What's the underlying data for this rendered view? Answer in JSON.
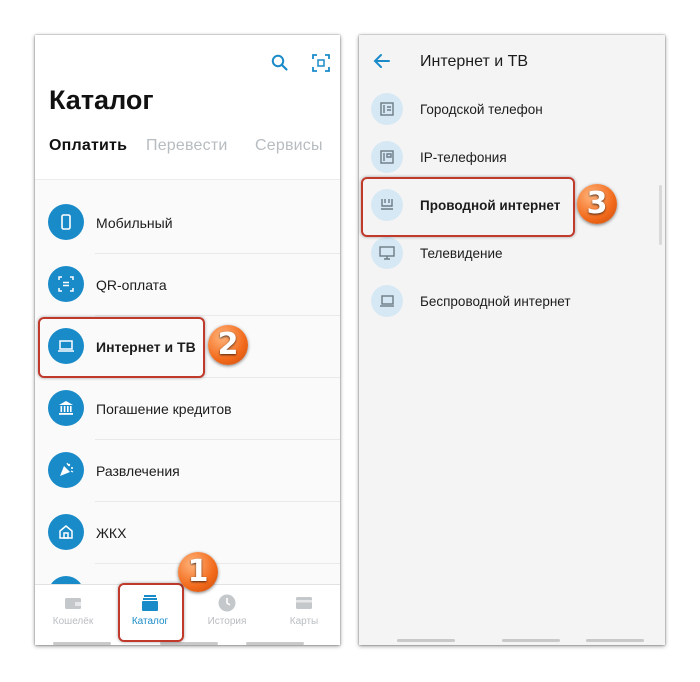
{
  "left": {
    "header": {
      "title": "Каталог",
      "search_icon": "search-icon",
      "qr_icon": "qr-scan-icon"
    },
    "tabs": [
      {
        "label": "Оплатить",
        "active": true
      },
      {
        "label": "Перевести",
        "active": false
      },
      {
        "label": "Сервисы",
        "active": false
      }
    ],
    "items": [
      {
        "label": "Мобильный",
        "icon": "phone-icon"
      },
      {
        "label": "QR-оплата",
        "icon": "qr-icon"
      },
      {
        "label": "Интернет и ТВ",
        "icon": "laptop-icon"
      },
      {
        "label": "Погашение кредитов",
        "icon": "bank-icon"
      },
      {
        "label": "Развлечения",
        "icon": "party-icon"
      },
      {
        "label": "ЖКХ",
        "icon": "house-icon"
      }
    ],
    "bottom_nav": [
      {
        "label": "Кошелёк",
        "icon": "wallet-icon",
        "active": false
      },
      {
        "label": "Каталог",
        "icon": "catalog-icon",
        "active": true
      },
      {
        "label": "История",
        "icon": "clock-icon",
        "active": false
      },
      {
        "label": "Карты",
        "icon": "card-icon",
        "active": false
      }
    ]
  },
  "right": {
    "header": {
      "title": "Интернет и ТВ",
      "back_icon": "back-arrow-icon"
    },
    "items": [
      {
        "label": "Городской телефон",
        "icon": "landline-icon"
      },
      {
        "label": "IP-телефония",
        "icon": "ip-phone-icon"
      },
      {
        "label": "Проводной интернет",
        "icon": "router-icon"
      },
      {
        "label": "Телевидение",
        "icon": "tv-icon"
      },
      {
        "label": "Беспроводной интернет",
        "icon": "wireless-icon"
      }
    ]
  },
  "callouts": {
    "step1": "1",
    "step2": "2",
    "step3": "3"
  },
  "colors": {
    "accent": "#1a8bc9",
    "callout": "#f26a1b",
    "highlight_border": "#c0392b"
  }
}
